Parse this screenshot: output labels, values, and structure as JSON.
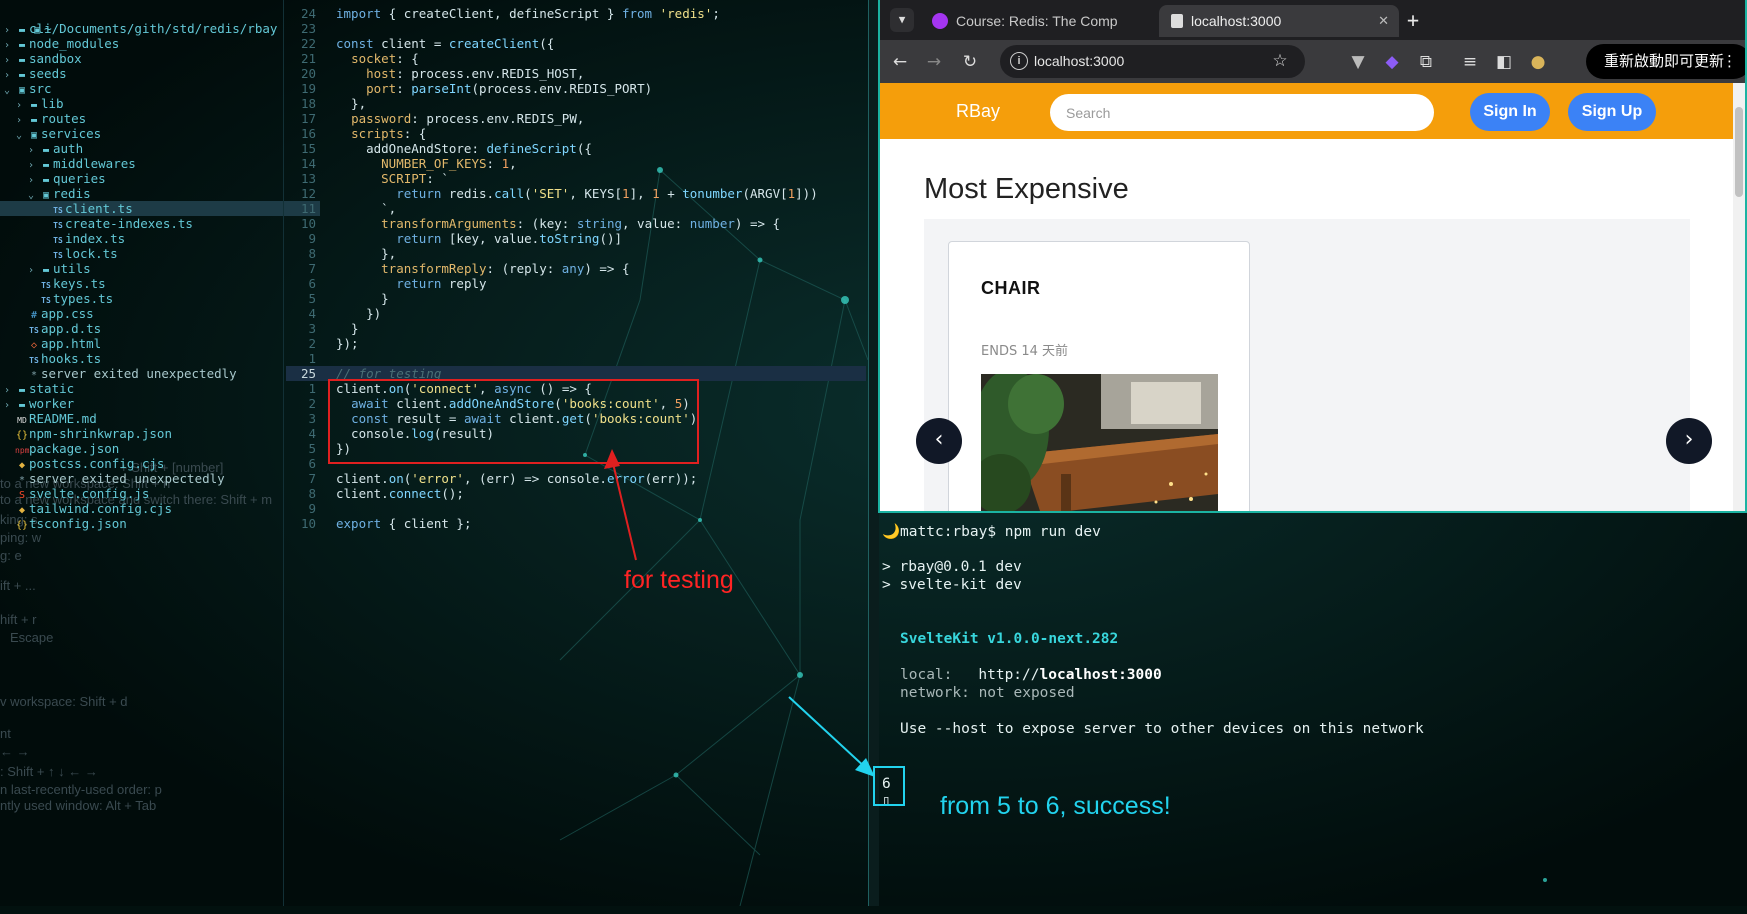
{
  "colors": {
    "terminal_accent": "#38d6dc",
    "annotation_red": "#ff2424",
    "annotation_cyan": "#22d3ee",
    "navbar": "#f59e0b",
    "button_blue": "#3b82f6"
  },
  "file_tree": {
    "root": "~/Documents/gith/std/redis/rbay",
    "items": [
      {
        "label": "cli",
        "icon": "folder-icon"
      },
      {
        "label": "node_modules",
        "icon": "folder-icon"
      },
      {
        "label": "sandbox",
        "icon": "folder-icon"
      },
      {
        "label": "seeds",
        "icon": "folder-icon"
      },
      {
        "label": "src",
        "icon": "folder-open-icon"
      },
      {
        "label": "lib",
        "icon": "folder-icon"
      },
      {
        "label": "routes",
        "icon": "folder-icon"
      },
      {
        "label": "services",
        "icon": "folder-open-icon"
      },
      {
        "label": "auth",
        "icon": "folder-icon"
      },
      {
        "label": "middlewares",
        "icon": "folder-icon"
      },
      {
        "label": "queries",
        "icon": "folder-icon"
      },
      {
        "label": "redis",
        "icon": "folder-open-icon"
      },
      {
        "label": "client.ts",
        "icon": "typescript-file-icon"
      },
      {
        "label": "create-indexes.ts",
        "icon": "typescript-file-icon"
      },
      {
        "label": "index.ts",
        "icon": "typescript-file-icon"
      },
      {
        "label": "lock.ts",
        "icon": "typescript-file-icon"
      },
      {
        "label": "utils",
        "icon": "folder-icon"
      },
      {
        "label": "keys.ts",
        "icon": "typescript-file-icon"
      },
      {
        "label": "types.ts",
        "icon": "typescript-file-icon"
      },
      {
        "label": "app.css",
        "icon": "css-file-icon"
      },
      {
        "label": "app.d.ts",
        "icon": "typescript-file-icon"
      },
      {
        "label": "app.html",
        "icon": "html-file-icon"
      },
      {
        "label": "hooks.ts",
        "icon": "typescript-file-icon"
      },
      {
        "label": "server exited unexpectedly",
        "icon": "asterisk-icon"
      },
      {
        "label": "static",
        "icon": "folder-icon"
      },
      {
        "label": "worker",
        "icon": "folder-icon"
      },
      {
        "label": "README.md",
        "icon": "markdown-file-icon"
      },
      {
        "label": "npm-shrinkwrap.json",
        "icon": "json-file-icon"
      },
      {
        "label": "package.json",
        "icon": "npm-file-icon"
      },
      {
        "label": "postcss.config.cjs",
        "icon": "js-file-icon"
      },
      {
        "label": "server exited unexpectedly",
        "icon": "asterisk-icon"
      },
      {
        "label": "svelte.config.js",
        "icon": "svelte-file-icon"
      },
      {
        "label": "tailwind.config.cjs",
        "icon": "js-file-icon"
      },
      {
        "label": "tsconfig.json",
        "icon": "json-file-icon"
      }
    ]
  },
  "ghost_help": [
    "+ Shift + [number]",
    "to a new workspace: Shift + n",
    "to a new workspace and switch there: Shift + m",
    "king: s",
    "ping: w",
    "g: e",
    "ift + ...",
    "hift + r",
    "Escape",
    "v workspace: Shift + d",
    "nt",
    "← →",
    ": Shift + ↑ ↓ ← →",
    "n last-recently-used order: p",
    "ntly used window: Alt + Tab"
  ],
  "editor": {
    "lines": [
      {
        "n": "24",
        "t": "import { createClient, defineScript } from 'redis';"
      },
      {
        "n": "23",
        "t": ""
      },
      {
        "n": "22",
        "t": "const client = createClient({"
      },
      {
        "n": "21",
        "t": "  socket: {"
      },
      {
        "n": "20",
        "t": "    host: process.env.REDIS_HOST,"
      },
      {
        "n": "19",
        "t": "    port: parseInt(process.env.REDIS_PORT)"
      },
      {
        "n": "18",
        "t": "  },"
      },
      {
        "n": "17",
        "t": "  password: process.env.REDIS_PW,"
      },
      {
        "n": "16",
        "t": "  scripts: {"
      },
      {
        "n": "15",
        "t": "    addOneAndStore: defineScript({"
      },
      {
        "n": "14",
        "t": "      NUMBER_OF_KEYS: 1,"
      },
      {
        "n": "13",
        "t": "      SCRIPT: `"
      },
      {
        "n": "12",
        "t": "        return redis.call('SET', KEYS[1], 1 + tonumber(ARGV[1]))"
      },
      {
        "n": "11",
        "t": "      `,"
      },
      {
        "n": "10",
        "t": "      transformArguments: (key: string, value: number) => {"
      },
      {
        "n": "9",
        "t": "        return [key, value.toString()]"
      },
      {
        "n": "8",
        "t": "      },"
      },
      {
        "n": "7",
        "t": "      transformReply: (reply: any) => {"
      },
      {
        "n": "6",
        "t": "        return reply"
      },
      {
        "n": "5",
        "t": "      }"
      },
      {
        "n": "4",
        "t": "    })"
      },
      {
        "n": "3",
        "t": "  }"
      },
      {
        "n": "2",
        "t": "});"
      },
      {
        "n": "1",
        "t": ""
      },
      {
        "n": "25",
        "t": "// for testing"
      },
      {
        "n": "1",
        "t": "client.on('connect', async () => {"
      },
      {
        "n": "2",
        "t": "  await client.addOneAndStore('books:count', 5)"
      },
      {
        "n": "3",
        "t": "  const result = await client.get('books:count')"
      },
      {
        "n": "4",
        "t": "  console.log(result)"
      },
      {
        "n": "5",
        "t": "})"
      },
      {
        "n": "6",
        "t": ""
      },
      {
        "n": "7",
        "t": "client.on('error', (err) => console.error(err));"
      },
      {
        "n": "8",
        "t": "client.connect();"
      },
      {
        "n": "9",
        "t": ""
      },
      {
        "n": "10",
        "t": "export { client };"
      }
    ],
    "annotation": "for testing"
  },
  "browser": {
    "tabs": [
      {
        "title": "Course: Redis: The Comp",
        "active": false
      },
      {
        "title": "localhost:3000",
        "active": true
      }
    ],
    "url": "localhost:3000",
    "update_button": "重新啟動即可更新",
    "page": {
      "brand": "RBay",
      "search_placeholder": "Search",
      "sign_in": "Sign In",
      "sign_up": "Sign Up",
      "heading": "Most Expensive",
      "card": {
        "title": "CHAIR",
        "ends": "ENDS 14 天前"
      }
    }
  },
  "terminal": {
    "prompt": "🌙mattc:rbay$ npm run dev",
    "lines": [
      "> rbay@0.0.1 dev",
      "> svelte-kit dev"
    ],
    "kit": "SvelteKit v1.0.0-next.282",
    "local_label": "local:",
    "local_url_prefix": "http://",
    "local_url_host": "localhost:3000",
    "network": "network: not exposed",
    "hint": "Use --host to expose server to other devices on this network",
    "result": "6",
    "annotation": "from 5 to 6, success!"
  }
}
